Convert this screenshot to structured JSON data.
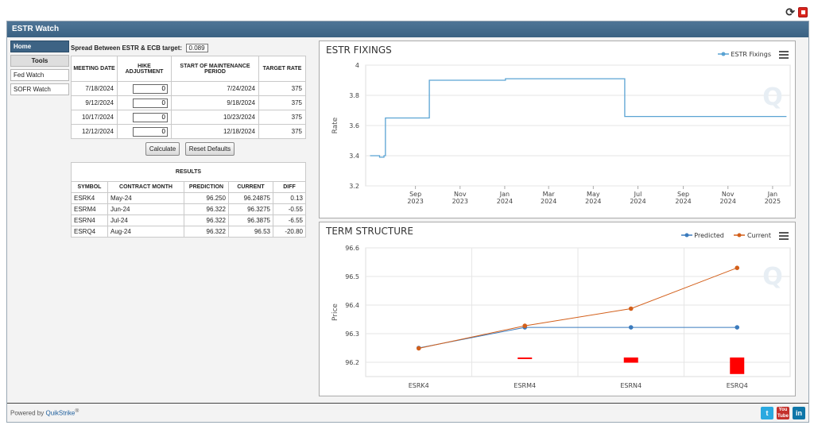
{
  "app": {
    "title": "ESTR Watch",
    "footer_text": "Powered by",
    "footer_brand": "QuikStrike",
    "footer_reg": "®"
  },
  "sidebar": {
    "items": [
      {
        "label": "Home",
        "active": true
      },
      {
        "label": "Tools",
        "group": true
      },
      {
        "label": "Fed Watch"
      },
      {
        "label": "SOFR Watch"
      }
    ]
  },
  "calculator": {
    "spread_label": "Spread Between ESTR & ECB target:",
    "spread_value": "0.089",
    "headers": [
      "MEETING DATE",
      "HIKE ADJUSTMENT",
      "START OF MAINTENANCE PERIOD",
      "TARGET RATE"
    ],
    "rows": [
      {
        "date": "7/18/2024",
        "hike": "0",
        "start": "7/24/2024",
        "rate": "375"
      },
      {
        "date": "9/12/2024",
        "hike": "0",
        "start": "9/18/2024",
        "rate": "375"
      },
      {
        "date": "10/17/2024",
        "hike": "0",
        "start": "10/23/2024",
        "rate": "375"
      },
      {
        "date": "12/12/2024",
        "hike": "0",
        "start": "12/18/2024",
        "rate": "375"
      }
    ],
    "calc_label": "Calculate",
    "reset_label": "Reset Defaults"
  },
  "results": {
    "title": "RESULTS",
    "headers": [
      "SYMBOL",
      "CONTRACT MONTH",
      "PREDICTION",
      "CURRENT",
      "DIFF"
    ],
    "rows": [
      {
        "symbol": "ESRK4",
        "month": "May-24",
        "prediction": "96.250",
        "current": "96.24875",
        "diff": "0.13"
      },
      {
        "symbol": "ESRM4",
        "month": "Jun-24",
        "prediction": "96.322",
        "current": "96.3275",
        "diff": "-0.55"
      },
      {
        "symbol": "ESRN4",
        "month": "Jul-24",
        "prediction": "96.322",
        "current": "96.3875",
        "diff": "-6.55"
      },
      {
        "symbol": "ESRQ4",
        "month": "Aug-24",
        "prediction": "96.322",
        "current": "96.53",
        "diff": "-20.80"
      }
    ]
  },
  "fixings": {
    "title": "ESTR FIXINGS",
    "legend": "ESTR Fixings",
    "ylabel": "Rate",
    "color": "#5aa3d3"
  },
  "term": {
    "title": "TERM STRUCTURE",
    "legend_predicted": "Predicted",
    "legend_current": "Current",
    "ylabel": "Price",
    "predicted_color": "#3b7bbd",
    "current_color": "#d35f1a"
  },
  "chart_data": [
    {
      "type": "line",
      "title": "ESTR FIXINGS",
      "ylabel": "Rate",
      "ylim": [
        3.2,
        4
      ],
      "yticks": [
        "4",
        "3.8",
        "3.6",
        "3.4",
        "3.2"
      ],
      "xticks": [
        [
          "Sep",
          "2023"
        ],
        [
          "Nov",
          "2023"
        ],
        [
          "Jan",
          "2024"
        ],
        [
          "Mar",
          "2024"
        ],
        [
          "May",
          "2024"
        ],
        [
          "Jul",
          "2024"
        ],
        [
          "Sep",
          "2024"
        ],
        [
          "Nov",
          "2024"
        ],
        [
          "Jan",
          "2025"
        ]
      ],
      "series": [
        {
          "name": "ESTR Fixings",
          "points": [
            [
              "2023-07-01",
              3.4
            ],
            [
              "2023-07-10",
              3.4
            ],
            [
              "2023-07-14",
              3.39
            ],
            [
              "2023-07-20",
              3.4
            ],
            [
              "2023-07-22",
              3.65
            ],
            [
              "2023-08-15",
              3.65
            ],
            [
              "2023-09-10",
              3.65
            ],
            [
              "2023-09-19",
              3.65
            ],
            [
              "2023-09-20",
              3.9
            ],
            [
              "2023-10-15",
              3.9
            ],
            [
              "2023-11-20",
              3.9
            ],
            [
              "2024-01-02",
              3.91
            ],
            [
              "2024-03-01",
              3.91
            ],
            [
              "2024-04-30",
              3.91
            ],
            [
              "2024-06-12",
              3.91
            ],
            [
              "2024-06-13",
              3.66
            ],
            [
              "2024-09-01",
              3.66
            ],
            [
              "2024-12-01",
              3.66
            ],
            [
              "2025-01-20",
              3.66
            ]
          ]
        }
      ]
    },
    {
      "type": "line",
      "title": "TERM STRUCTURE",
      "ylabel": "Price",
      "ylim": [
        96.15,
        96.6
      ],
      "yticks": [
        "96.6",
        "96.5",
        "96.4",
        "96.3",
        "96.2"
      ],
      "categories": [
        "ESRK4",
        "ESRM4",
        "ESRN4",
        "ESRQ4"
      ],
      "series": [
        {
          "name": "Predicted",
          "values": [
            96.25,
            96.322,
            96.322,
            96.322
          ]
        },
        {
          "name": "Current",
          "values": [
            96.24875,
            96.3275,
            96.3875,
            96.53
          ]
        },
        {
          "name": "Diff",
          "values": [
            0.13,
            -0.55,
            -6.55,
            -20.8
          ]
        }
      ]
    }
  ]
}
